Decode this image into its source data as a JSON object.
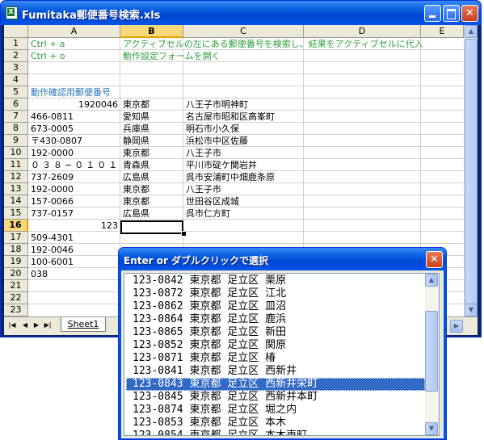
{
  "window": {
    "title": "Fumitaka郵便番号検索.xls"
  },
  "columns": [
    "A",
    "B",
    "C",
    "D",
    "E"
  ],
  "rows": [
    "1",
    "2",
    "3",
    "4",
    "5",
    "6",
    "7",
    "8",
    "9",
    "10",
    "11",
    "12",
    "13",
    "14",
    "15",
    "16",
    "17",
    "18",
    "19",
    "20",
    "21",
    "22",
    "23"
  ],
  "cells": {
    "r1": {
      "a": "Ctrl + a",
      "b": "アクティブセルの左にある郵便番号を検索し、結果をアクティブセルに代入"
    },
    "r2": {
      "a": "Ctrl + o",
      "b": "動作設定フォームを開く"
    },
    "r5": {
      "a": "動作確認用郵便番号"
    },
    "r6": {
      "a": "1920046",
      "b": "東京都",
      "c": "八王子市明神町"
    },
    "r7": {
      "a": "466-0811",
      "b": "愛知県",
      "c": "名古屋市昭和区高峯町"
    },
    "r8": {
      "a": "673-0005",
      "b": "兵庫県",
      "c": "明石市小久保"
    },
    "r9": {
      "a": "〒430-0807",
      "b": "静岡県",
      "c": "浜松市中区佐藤"
    },
    "r10": {
      "a": "192-0000",
      "b": "東京都",
      "c": "八王子市"
    },
    "r11": {
      "a": "０３８−０１０１",
      "b": "青森県",
      "c": "平川市碇ケ関岩井"
    },
    "r12": {
      "a": "737-2609",
      "b": "広島県",
      "c": "呉市安浦町中畑鹿条原"
    },
    "r13": {
      "a": "192-0000",
      "b": "東京都",
      "c": "八王子市"
    },
    "r14": {
      "a": "157-0066",
      "b": "東京都",
      "c": "世田谷区成城"
    },
    "r15": {
      "a": "737-0157",
      "b": "広島県",
      "c": "呉市仁方町"
    },
    "r16": {
      "a": "123"
    },
    "r17": {
      "a": "509-4301"
    },
    "r18": {
      "a": "192-0046"
    },
    "r19": {
      "a": "100-6001"
    },
    "r20": {
      "a": "038"
    }
  },
  "sheet_tab": "Sheet1",
  "dialog": {
    "title": "Enter or ダブルクリックで選択",
    "items": [
      "123-0842 東京都 足立区 栗原",
      "123-0872 東京都 足立区 江北",
      "123-0862 東京都 足立区 皿沼",
      "123-0864 東京都 足立区 鹿浜",
      "123-0865 東京都 足立区 新田",
      "123-0852 東京都 足立区 関原",
      "123-0871 東京都 足立区 椿",
      "123-0841 東京都 足立区 西新井",
      "123-0843 東京都 足立区 西新井栄町",
      "123-0845 東京都 足立区 西新井本町",
      "123-0874 東京都 足立区 堀之内",
      "123-0853 東京都 足立区 本木",
      "123-0854 東京都 足立区 本木東町"
    ],
    "selected_index": 8
  }
}
